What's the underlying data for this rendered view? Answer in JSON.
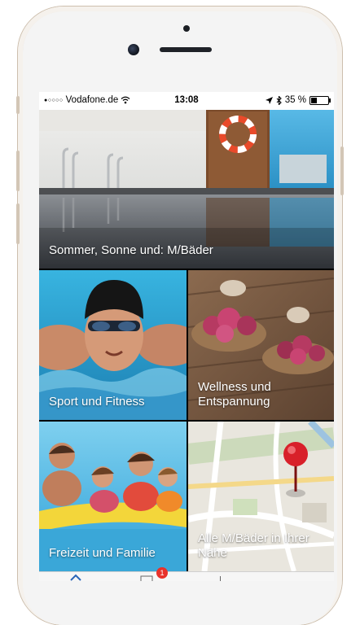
{
  "statusbar": {
    "carrier": "Vodafone.de",
    "time": "13:08",
    "battery": "35 %",
    "battery_level": 0.35
  },
  "hero": {
    "label": "Sommer, Sonne und: M/Bäder"
  },
  "tiles": [
    {
      "label": "Sport und Fitness"
    },
    {
      "label": "Wellness und Entspannung"
    },
    {
      "label": "Freizeit und Familie"
    },
    {
      "label": "Alle M/Bäder in Ihrer Nähe"
    }
  ],
  "tabbar": {
    "badge_count": "1",
    "icons": [
      "home-icon",
      "mail-icon",
      "more-icon"
    ]
  },
  "colors": {
    "badge": "#e8322b",
    "pool_blue": "#2fa6d6",
    "map_pin": "#d8202a"
  }
}
